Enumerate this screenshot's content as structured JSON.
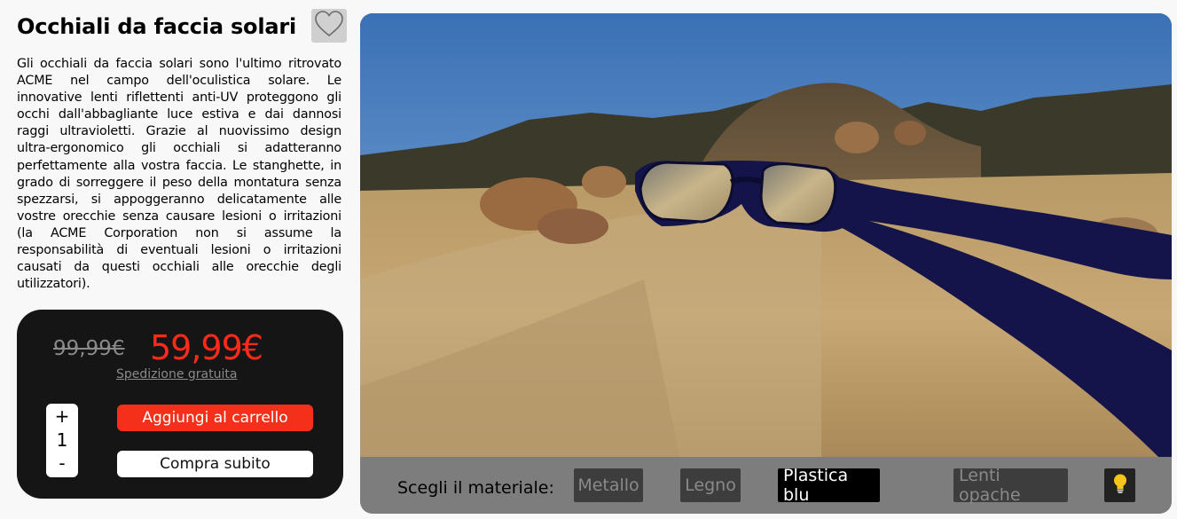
{
  "product": {
    "title": "Occhiali da faccia solari",
    "favorite_icon": "heart-icon",
    "description": "Gli occhiali da faccia solari sono l'ultimo ritrovato ACME nel campo dell'oculistica solare. Le innovative lenti riflettenti anti-UV proteggono gli occhi dall'abbagliante luce estiva e dai dannosi raggi ultravioletti. Grazie al nuovissimo design ultra-ergonomico gli occhiali si adatteranno perfettamente alla vostra faccia. Le stanghette, in grado di sorreggere il peso della montatura senza spezzarsi, si appoggeranno delicatamente alle vostre orecchie senza causare lesioni o irritazioni (la ACME Corporation non si assume la responsabilità di eventuali lesioni o irritazioni causati da questi occhiali alle orecchie degli utilizzatori)."
  },
  "purchase": {
    "old_price": "99,99€",
    "new_price": "59,99€",
    "shipping": "Spedizione gratuita",
    "qty_plus": "+",
    "quantity": "1",
    "qty_minus": "-",
    "add_to_cart": "Aggiungi al carrello",
    "buy_now": "Compra subito"
  },
  "viewer": {
    "material_label": "Scegli il materiale:",
    "materials": [
      {
        "label": "Metallo",
        "active": false
      },
      {
        "label": "Legno",
        "active": false
      },
      {
        "label": "Plastica blu",
        "active": true
      }
    ],
    "lens_option": "Lenti opache",
    "light_icon": "lightbulb-icon"
  },
  "colors": {
    "price_red": "#ff2a1a",
    "cart_button": "#f4301b",
    "buy_box": "#151515",
    "frame_blue": "#14144a",
    "sky_blue": "#3f78b8"
  }
}
